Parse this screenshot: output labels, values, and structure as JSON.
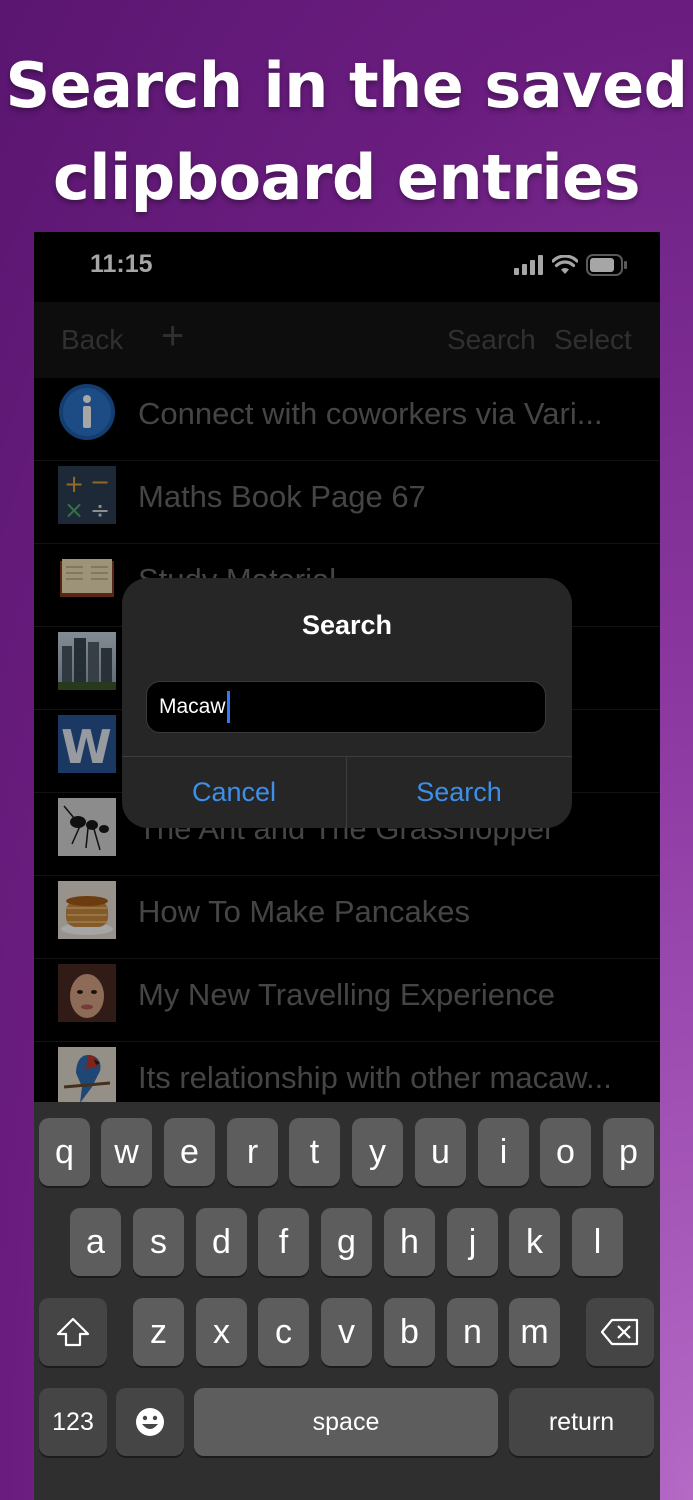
{
  "headline": {
    "line1": "Search in the saved",
    "line2": "clipboard entries"
  },
  "status_bar": {
    "time": "11:15"
  },
  "navbar": {
    "back": "Back",
    "add": "+",
    "search": "Search",
    "select": "Select"
  },
  "list": [
    {
      "title": "Connect with coworkers via Vari...",
      "icon": "info-icon"
    },
    {
      "title": "Maths Book Page 67",
      "icon": "calculator-icon"
    },
    {
      "title": "Study Material",
      "icon": "book-icon"
    },
    {
      "title": "",
      "icon": "buildings-photo"
    },
    {
      "title": "",
      "icon": "word-icon"
    },
    {
      "title": "The Ant and The Grasshopper",
      "icon": "ant-photo"
    },
    {
      "title": "How To Make Pancakes",
      "icon": "pancakes-photo"
    },
    {
      "title": "My New Travelling Experience",
      "icon": "portrait-photo"
    },
    {
      "title": "Its relationship with other macaw...",
      "icon": "macaw-photo"
    }
  ],
  "dialog": {
    "title": "Search",
    "input_value": "Macaw",
    "cancel": "Cancel",
    "confirm": "Search"
  },
  "keyboard": {
    "row1": [
      "q",
      "w",
      "e",
      "r",
      "t",
      "y",
      "u",
      "i",
      "o",
      "p"
    ],
    "row2": [
      "a",
      "s",
      "d",
      "f",
      "g",
      "h",
      "j",
      "k",
      "l"
    ],
    "row3": [
      "z",
      "x",
      "c",
      "v",
      "b",
      "n",
      "m"
    ],
    "numbers": "123",
    "space": "space",
    "return": "return"
  },
  "colors": {
    "accent": "#3d8fe8",
    "background": "#7a2a91"
  }
}
